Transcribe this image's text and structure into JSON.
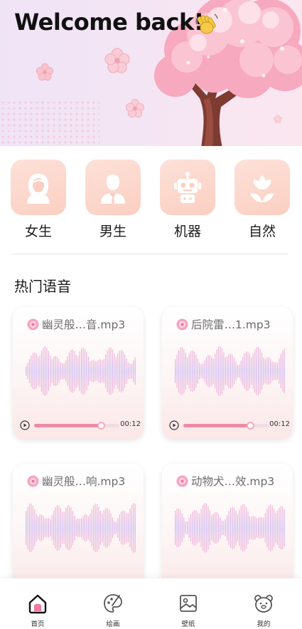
{
  "header": {
    "welcome_text": "Welcome back!",
    "wave_emoji_icon": "waving-hand-icon"
  },
  "categories": [
    {
      "label": "女生",
      "icon": "woman-icon"
    },
    {
      "label": "男生",
      "icon": "man-icon"
    },
    {
      "label": "机器",
      "icon": "robot-icon"
    },
    {
      "label": "自然",
      "icon": "tulip-icon"
    }
  ],
  "section": {
    "title": "热门语音"
  },
  "sounds": [
    {
      "name": "幽灵般…音.mp3",
      "time": "00:12",
      "progress": 0.78
    },
    {
      "name": "后院雷…1.mp3",
      "time": "00:12",
      "progress": 0.78
    },
    {
      "name": "幽灵般…响.mp3",
      "time": "",
      "progress": 0
    },
    {
      "name": "动物犬…效.mp3",
      "time": "",
      "progress": 0
    }
  ],
  "tabbar": {
    "items": [
      {
        "label": "首页",
        "icon": "home-icon",
        "active": true
      },
      {
        "label": "绘画",
        "icon": "palette-icon",
        "active": false
      },
      {
        "label": "壁纸",
        "icon": "image-icon",
        "active": false
      },
      {
        "label": "我的",
        "icon": "bear-icon",
        "active": false
      }
    ]
  },
  "colors": {
    "accent_pink": "#ee8ba5",
    "tile_peach": "#fbcfc1",
    "wave_purple": "#c9b4f0",
    "wave_pink": "#f4b6d4"
  }
}
